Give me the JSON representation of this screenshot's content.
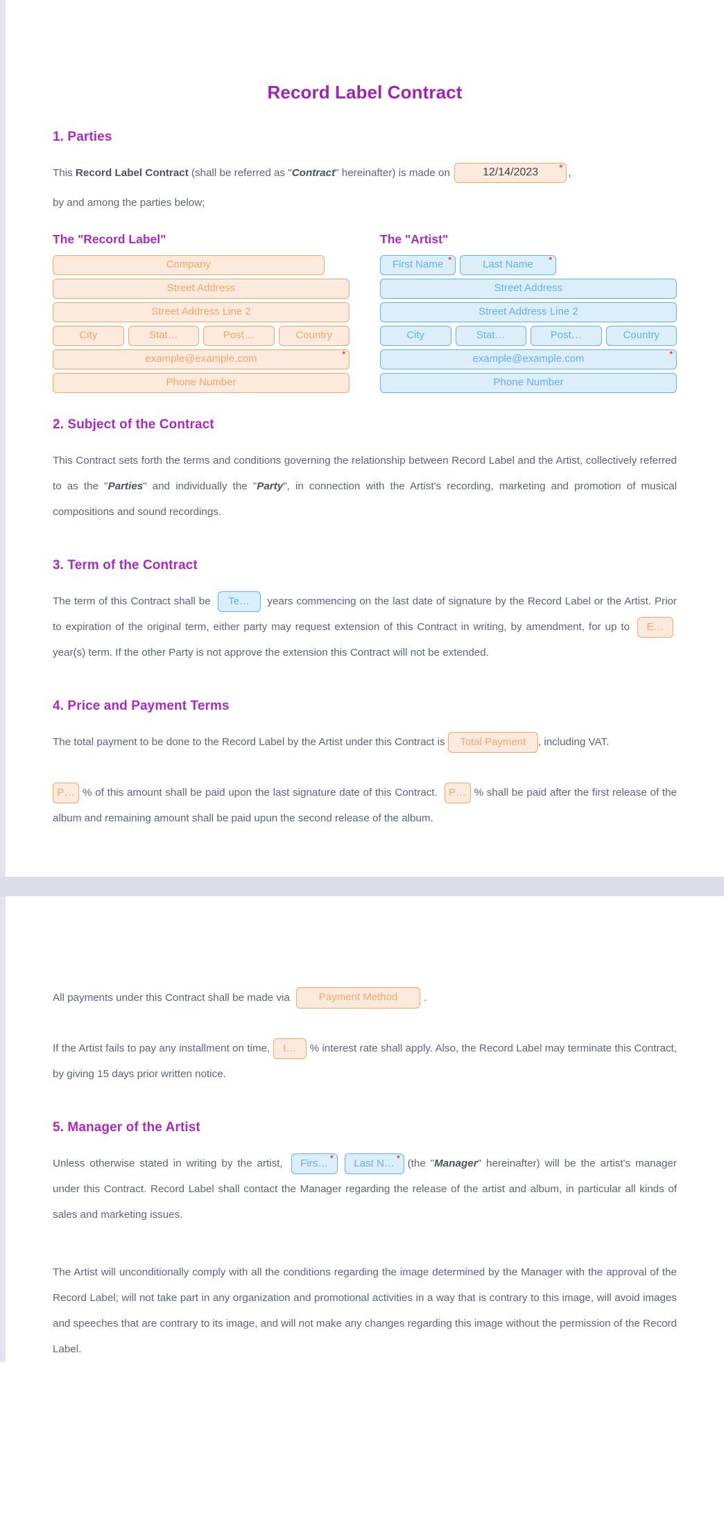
{
  "document": {
    "title": "Record Label Contract",
    "accent_purple": "#a72bbd",
    "body_text_color": "#5b6478",
    "orange_field_border": "#f0a869",
    "orange_field_bg": "#fdeade",
    "blue_field_border": "#5eb3ef",
    "blue_field_bg": "#ddeefb",
    "required_marker": "*"
  },
  "section1": {
    "heading": "1. Parties",
    "intro_a": "This ",
    "intro_bold": "Record Label Contract",
    "intro_b": " (shall be referred as \"",
    "intro_bi": "Contract",
    "intro_c": "\" hereinafter) is made on ",
    "date_value": "12/14/2023",
    "intro_d": ",",
    "intro_line2": "by and among the parties below;",
    "record_label": {
      "heading": "The \"Record Label\"",
      "company": "Company",
      "street_address": "Street Address",
      "street_address_2": "Street Address Line 2",
      "city": "City",
      "state": "Stat…",
      "postal": "Post…",
      "country": "Country",
      "email": "example@example.com",
      "phone": "Phone Number"
    },
    "artist": {
      "heading": "The \"Artist\"",
      "first_name": "First Name",
      "last_name": "Last Name",
      "street_address": "Street Address",
      "street_address_2": "Street Address Line 2",
      "city": "City",
      "state": "Stat…",
      "postal": "Post…",
      "country": "Country",
      "email": "example@example.com",
      "phone": "Phone Number"
    }
  },
  "section2": {
    "heading": "2. Subject of the Contract",
    "text_a": "This Contract sets forth the terms and conditions governing the relationship between Record Label and the Artist, collectively referred to as the \"",
    "text_parties": "Parties",
    "text_b": "\" and individually the \"",
    "text_party": "Party",
    "text_c": "\", in connection with the Artist's recording, marketing and promotion of musical compositions and sound recordings."
  },
  "section3": {
    "heading": "3. Term of the Contract",
    "text_a": "The term of this Contract shall be ",
    "term_field": "Te…",
    "text_b": " years commencing on the last date of signature by the Record Label or the Artist. Prior to expiration of the original term, either party may request extension of this Contract in writing, by amendment, for up to ",
    "extension_field": "E…",
    "text_c": " year(s) term. If the other Party is not approve the extension this Contract will not be extended."
  },
  "section4": {
    "heading": "4. Price and Payment Terms",
    "text_a": "The total payment to be done to the Record Label by the Artist under this Contract is",
    "total_payment_field": "Total Payment",
    "text_b": ", including VAT.",
    "percent_field_1": "P…",
    "text_c": "% of this amount shall be paid upon the last signature date of this Contract. ",
    "percent_field_2": "P…",
    "text_d": "% shall be paid after the first release of the album and remaining amount shall be paid upun the second release of the album.",
    "payment_via_a": "All payments under this Contract shall be made via ",
    "payment_method_field": "Payment Method",
    "payment_via_b": ".",
    "interest_a": "If the Artist fails to pay any installment on time, ",
    "interest_field": "I…",
    "interest_b": "% interest rate shall apply. Also, the Record Label may terminate this Contract, by giving 15 days prior written notice."
  },
  "section5": {
    "heading": "5. Manager of the Artist",
    "text_a": "Unless otherwise stated in writing by the artist, ",
    "manager_first_name": "Firs…",
    "manager_last_name": "Last N…",
    "text_b": "(the \"",
    "text_manager": "Manager",
    "text_c": "\" hereinafter) will be the artist's manager under this Contract. Record Label shall contact the Manager regarding the release of the artist and album, in particular all kinds of sales and marketing issues.",
    "paragraph2": "The Artist will unconditionally comply with all the conditions regarding the image determined by the Manager with the approval of the Record Label; will not take part in any organization and promotional activities in a way that is contrary to this image, will avoid images and speeches that are contrary to its image, and will not make any changes regarding this image without the permission of the Record Label."
  }
}
